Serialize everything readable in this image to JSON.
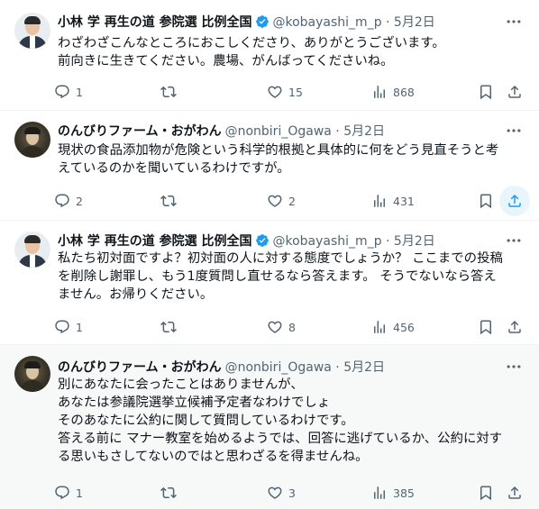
{
  "tweets": [
    {
      "name": "小林 学 再生の道 参院選 比例全国",
      "handle": "@kobayashi_m_p · 5月2日",
      "lines": [
        "わざわざこんなところにおこしくださり、ありがとうございます。",
        "前向きに生きてください。農場、がんばってくださいね。"
      ],
      "replies": "1",
      "retweets": "",
      "likes": "15",
      "views": "868"
    },
    {
      "name": "のんびりファーム・おがわん",
      "handle": "@nonbiri_Ogawa · 5月2日",
      "lines": [
        "現状の食品添加物が危険という科学的根拠と具体的に何をどう見直そうと考",
        "えているのかを聞いているわけですが。"
      ],
      "replies": "2",
      "retweets": "",
      "likes": "2",
      "views": "431"
    },
    {
      "name": "小林 学 再生の道 参院選 比例全国",
      "handle": "@kobayashi_m_p · 5月2日",
      "lines": [
        "私たち初対面ですよ？初対面の人に対する態度でしょうか？ ここまでの投稿",
        "を削除し謝罪し、もう1度質問し直せるなら答えます。 そうでないなら答え",
        "ません。お帰りください。"
      ],
      "replies": "1",
      "retweets": "",
      "likes": "8",
      "views": "456"
    },
    {
      "name": "のんびりファーム・おがわん",
      "handle": "@nonbiri_Ogawa · 5月2日",
      "lines": [
        "別にあなたに会ったことはありませんが、",
        "あなたは参議院選挙立候補予定者なわけでしょ",
        "そのあなたに公約に関して質問しているわけです。",
        "答える前に マナー教室を始めるようでは、回答に逃げているか、公約に対す",
        "る思いもさしてないのではと思わざるを得ませんね。"
      ],
      "replies": "1",
      "retweets": "",
      "likes": "3",
      "views": "385"
    }
  ],
  "icons": {
    "verified": "verified-badge-icon",
    "more": "more-dots-icon",
    "reply": "reply-icon",
    "retweet": "retweet-icon",
    "like": "like-icon",
    "views": "views-icon",
    "bookmark": "bookmark-icon",
    "share": "share-icon"
  },
  "colors": {
    "verified": "#1d9bf0",
    "icon": "#536471",
    "highlight_bg": "#f7f9f9",
    "share_hover": "#1d9bf0"
  }
}
